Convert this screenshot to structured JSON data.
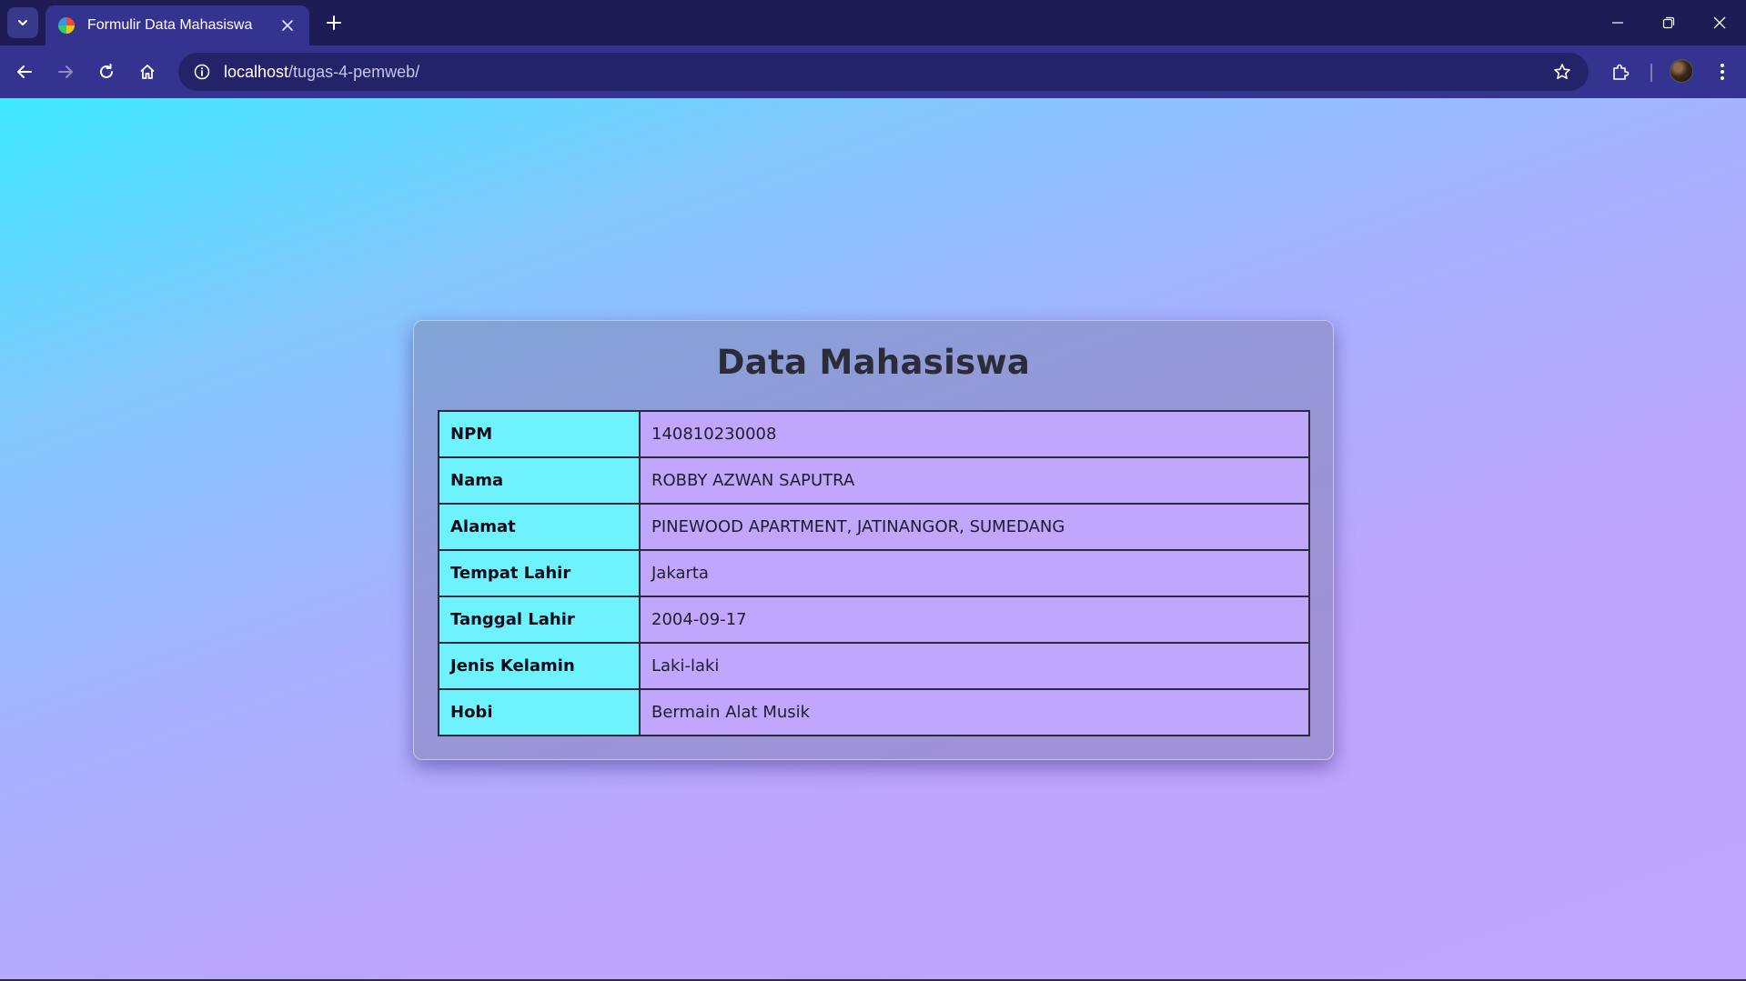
{
  "browser": {
    "tab_title": "Formulir Data Mahasiswa",
    "url_host": "localhost",
    "url_path": "/tugas-4-pemweb/",
    "icons": {
      "tab_search": "chevron-down-icon",
      "tab_close": "close-icon",
      "new_tab": "plus-icon",
      "minimize": "minimize-icon",
      "restore": "restore-icon",
      "close_window": "close-icon",
      "back": "arrow-left-icon",
      "forward": "arrow-right-icon",
      "reload": "reload-icon",
      "home": "home-icon",
      "site_info": "info-icon",
      "bookmark": "star-icon",
      "extensions": "puzzle-icon",
      "menu": "kebab-menu-icon"
    }
  },
  "page": {
    "title": "Data Mahasiswa",
    "rows": [
      {
        "label": "NPM",
        "value": "140810230008"
      },
      {
        "label": "Nama",
        "value": "ROBBY AZWAN SAPUTRA"
      },
      {
        "label": "Alamat",
        "value": "PINEWOOD APARTMENT, JATINANGOR, SUMEDANG"
      },
      {
        "label": "Tempat Lahir",
        "value": "Jakarta"
      },
      {
        "label": "Tanggal Lahir",
        "value": "2004-09-17"
      },
      {
        "label": "Jenis Kelamin",
        "value": "Laki-laki"
      },
      {
        "label": "Hobi",
        "value": "Bermain Alat Musik"
      }
    ]
  },
  "colors": {
    "browser_frame": "#1d1c55",
    "toolbar": "#343490",
    "label_cell": "#6ef2fd",
    "value_cell": "#c1a6fe",
    "gradient_start": "#3feafe",
    "gradient_end": "#c0a6fc"
  }
}
